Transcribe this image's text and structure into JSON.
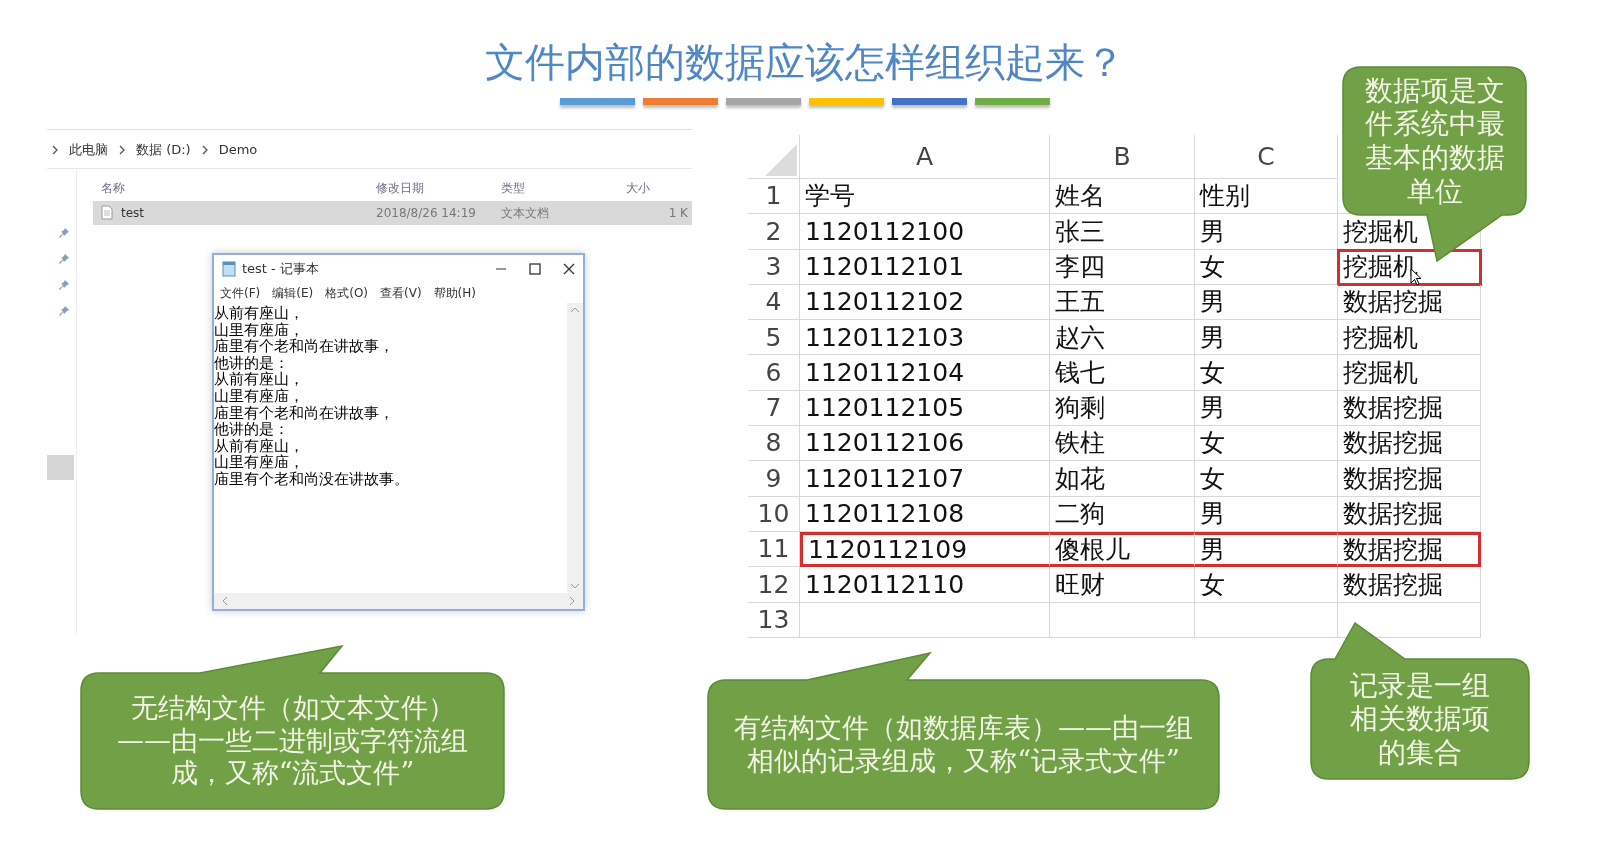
{
  "title": "文件内部的数据应该怎样组织起来？",
  "accent_bars": [
    {
      "color": "#5b9bd5"
    },
    {
      "color": "#ed7d31"
    },
    {
      "color": "#a5a5a5"
    },
    {
      "color": "#ffc000"
    },
    {
      "color": "#4472c4"
    },
    {
      "color": "#70ad47"
    }
  ],
  "explorer": {
    "breadcrumb": [
      "此电脑",
      "数据 (D:)",
      "Demo"
    ],
    "columns": [
      "名称",
      "修改日期",
      "类型",
      "大小"
    ],
    "files": [
      {
        "name": "test",
        "modified": "2018/8/26 14:19",
        "type": "文本文档",
        "size": "1 K",
        "selected": true
      }
    ]
  },
  "notepad": {
    "title": "test - 记事本",
    "menu": [
      "文件(F)",
      "编辑(E)",
      "格式(O)",
      "查看(V)",
      "帮助(H)"
    ],
    "lines": [
      "从前有座山，",
      "山里有座庙，",
      "庙里有个老和尚在讲故事，",
      "他讲的是：",
      "从前有座山，",
      "山里有座庙，",
      "庙里有个老和尚在讲故事，",
      "他讲的是：",
      "从前有座山，",
      "山里有座庙，",
      "庙里有个老和尚没在讲故事。"
    ]
  },
  "sheet": {
    "columns": [
      "A",
      "B",
      "C"
    ],
    "rows": [
      {
        "number": "1",
        "cells": [
          "学号",
          "姓名",
          "性别"
        ],
        "outlined": false,
        "last_cell_outlined": false
      },
      {
        "number": "2",
        "cells": [
          "1120112100",
          "张三",
          "男",
          "挖掘机"
        ],
        "outlined": false,
        "last_cell_outlined": false
      },
      {
        "number": "3",
        "cells": [
          "1120112101",
          "李四",
          "女",
          "挖掘机"
        ],
        "outlined": false,
        "last_cell_outlined": true
      },
      {
        "number": "4",
        "cells": [
          "1120112102",
          "王五",
          "男",
          "数据挖掘"
        ],
        "outlined": false,
        "last_cell_outlined": false
      },
      {
        "number": "5",
        "cells": [
          "1120112103",
          "赵六",
          "男",
          "挖掘机"
        ],
        "outlined": false,
        "last_cell_outlined": false
      },
      {
        "number": "6",
        "cells": [
          "1120112104",
          "钱七",
          "女",
          "挖掘机"
        ],
        "outlined": false,
        "last_cell_outlined": false
      },
      {
        "number": "7",
        "cells": [
          "1120112105",
          "狗剩",
          "男",
          "数据挖掘"
        ],
        "outlined": false,
        "last_cell_outlined": false
      },
      {
        "number": "8",
        "cells": [
          "1120112106",
          "铁柱",
          "女",
          "数据挖掘"
        ],
        "outlined": false,
        "last_cell_outlined": false
      },
      {
        "number": "9",
        "cells": [
          "1120112107",
          "如花",
          "女",
          "数据挖掘"
        ],
        "outlined": false,
        "last_cell_outlined": false
      },
      {
        "number": "10",
        "cells": [
          "1120112108",
          "二狗",
          "男",
          "数据挖掘"
        ],
        "outlined": false,
        "last_cell_outlined": false
      },
      {
        "number": "11",
        "cells": [
          "1120112109",
          "傻根儿",
          "男",
          "数据挖掘"
        ],
        "outlined": true,
        "last_cell_outlined": false
      },
      {
        "number": "12",
        "cells": [
          "1120112110",
          "旺财",
          "女",
          "数据挖掘"
        ],
        "outlined": false,
        "last_cell_outlined": false
      },
      {
        "number": "13",
        "cells": [],
        "outlined": false,
        "last_cell_outlined": false
      }
    ]
  },
  "callouts": [
    {
      "text": "无结构文件（如文本文件）——由一些二进制或字符流组成，又称“流式文件”"
    },
    {
      "text": "有结构文件（如数据库表）——由一组相似的记录组成，又称“记录式文件”"
    },
    {
      "text": "数据项是文件系统中最基本的数据单位"
    },
    {
      "text": "记录是一组相关数据项的集合"
    }
  ]
}
